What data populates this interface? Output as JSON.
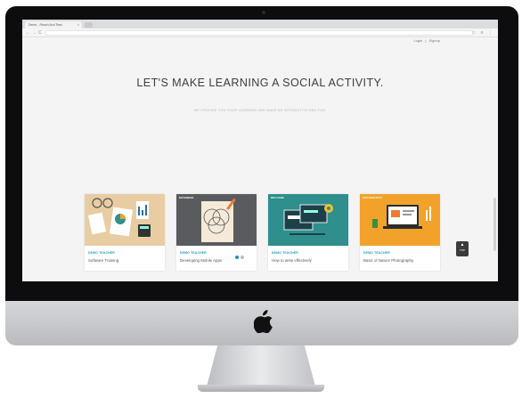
{
  "browser": {
    "tab_title": "Demo - Reach And Teac",
    "tab_close": "×",
    "nav_buttons": [
      "←",
      "→",
      "C"
    ],
    "toolbar_icons": "☆ ≡ ⋮"
  },
  "header": {
    "login": "Login",
    "separator": "|",
    "signup": "Signup"
  },
  "hero": {
    "title": "LET'S MAKE LEARNING A SOCIAL ACTIVITY.",
    "subtitle": "WE PROVIDE YOU YOUR LEARNING AND MAKE AN INTERACTIVE AND FUN."
  },
  "cards": [
    {
      "tag": "",
      "teacher": "DEMO TEACHER",
      "title": "Software Training",
      "bg": "#e9cda2"
    },
    {
      "tag": "NOVEMBER",
      "teacher": "DEMO TEACHER",
      "title": "Developing Mobile Apps",
      "bg": "#5a5b5e"
    },
    {
      "tag": "WELCOME",
      "teacher": "DEMO TEACHER",
      "title": "How to write effectively",
      "bg": "#2f8f8d"
    },
    {
      "tag": "PHOTOGRAPHY",
      "teacher": "DEMO TEACHER",
      "title": "Basic of Nature Photography",
      "bg": "#f2a22a"
    }
  ],
  "scroll_top": {
    "arrow": "▲",
    "label": "TOP"
  },
  "colors": {
    "accent": "#1d8fc4",
    "teacher_label": "#1f9ab9",
    "bezel": "#0d0d0f"
  }
}
